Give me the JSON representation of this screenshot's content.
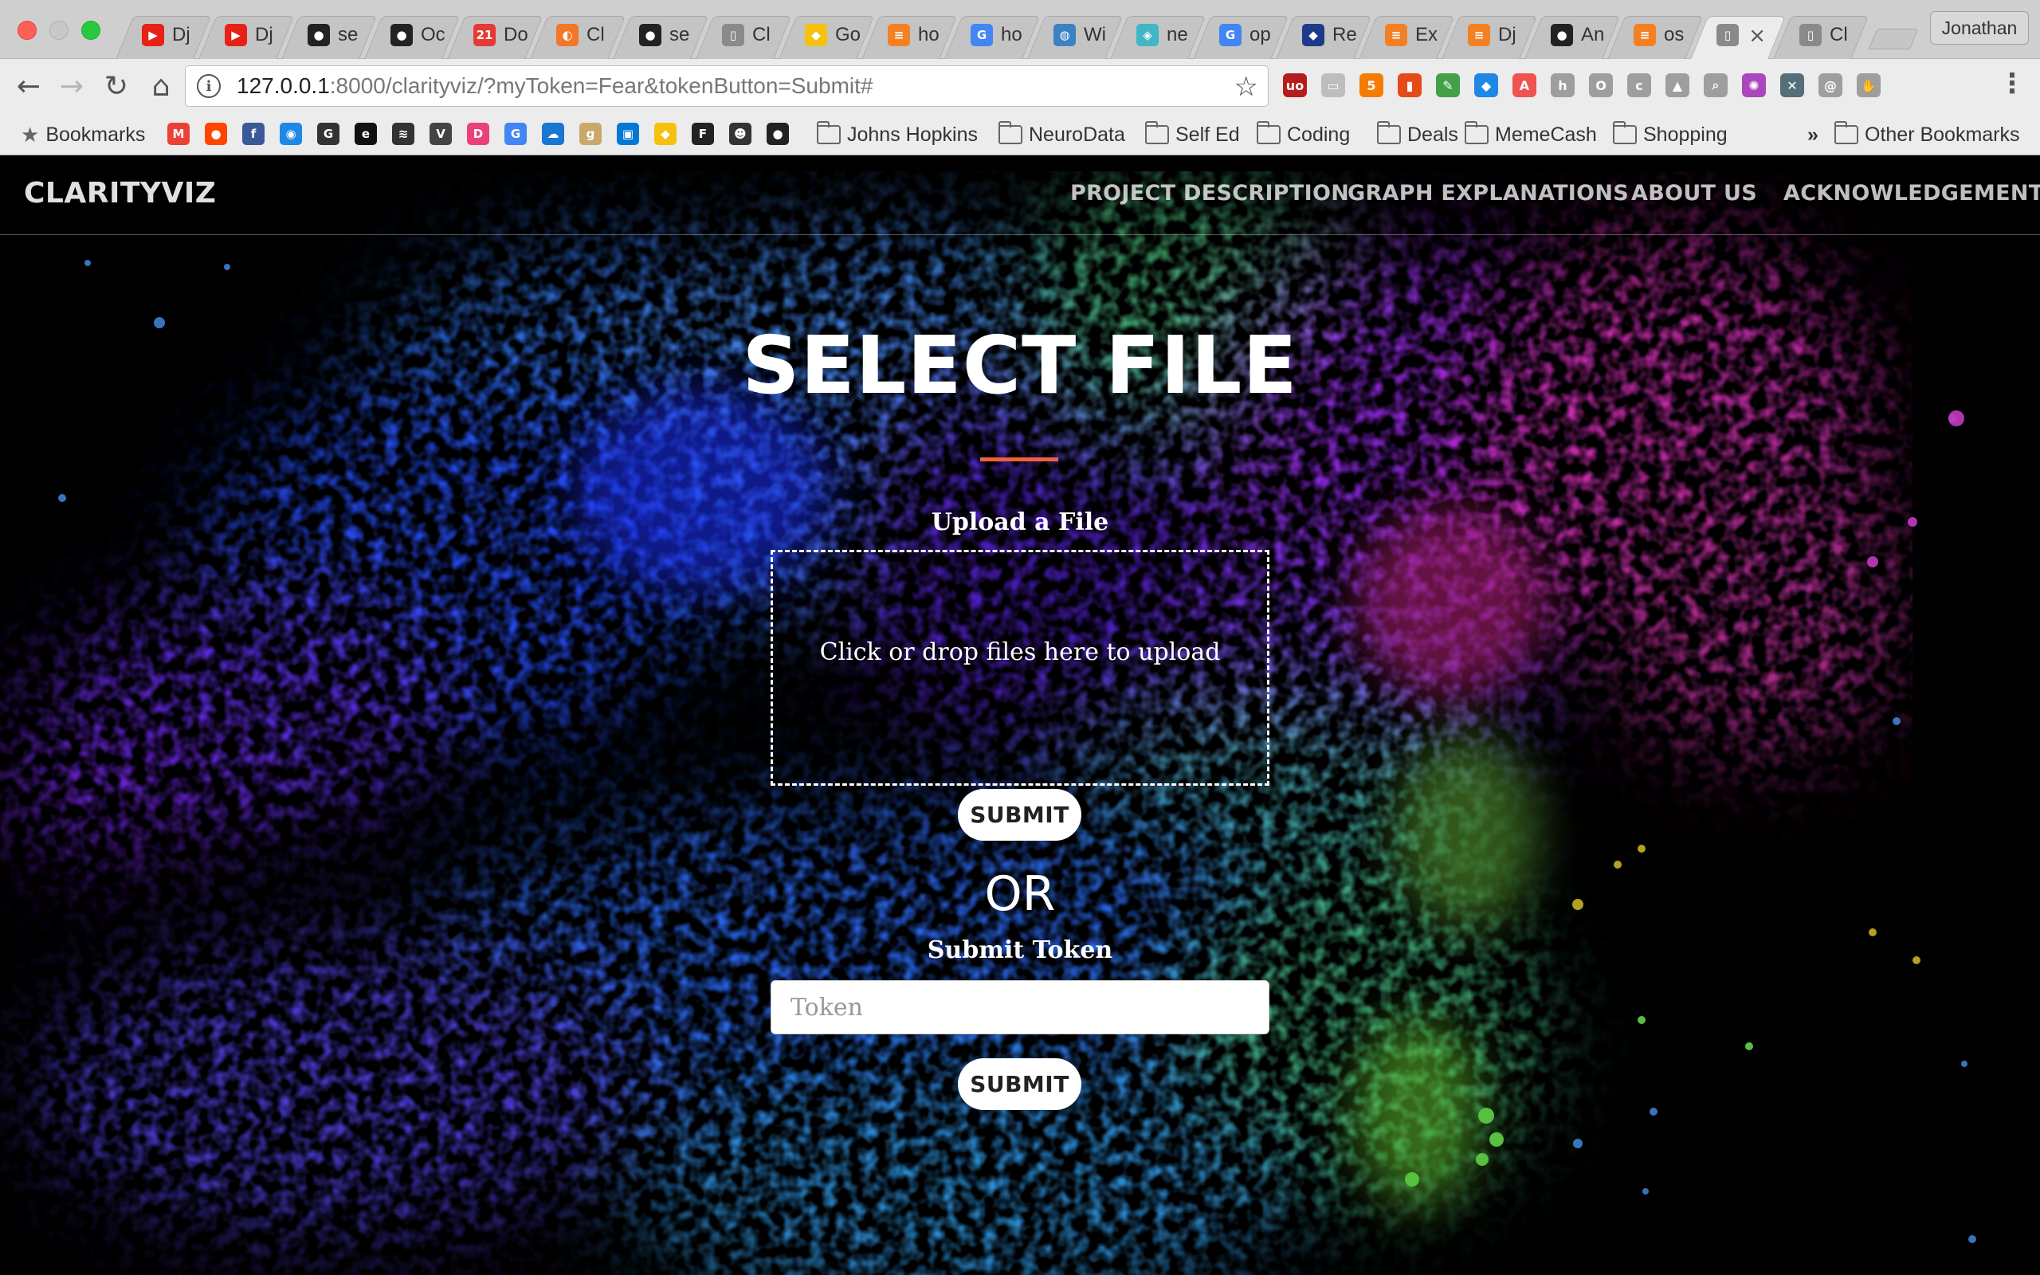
{
  "browser": {
    "tabs": [
      {
        "title": "Dj",
        "icon": "youtube-icon",
        "color": "#e62117",
        "glyph": "▶"
      },
      {
        "title": "Dj",
        "icon": "youtube-icon",
        "color": "#e62117",
        "glyph": "▶"
      },
      {
        "title": "se",
        "icon": "github-icon",
        "color": "#222222",
        "glyph": "●"
      },
      {
        "title": "Oc",
        "icon": "github-icon",
        "color": "#222222",
        "glyph": "●"
      },
      {
        "title": "Do",
        "icon": "calendar-icon",
        "color": "#e53935",
        "glyph": "21"
      },
      {
        "title": "Cl",
        "icon": "jupyter-icon",
        "color": "#f37726",
        "glyph": "◐"
      },
      {
        "title": "se",
        "icon": "github-icon",
        "color": "#222222",
        "glyph": "●"
      },
      {
        "title": "Cl",
        "icon": "document-icon",
        "color": "#8a8a8a",
        "glyph": "▯"
      },
      {
        "title": "Go",
        "icon": "lightbulb-icon",
        "color": "#f4c20d",
        "glyph": "◆"
      },
      {
        "title": "ho",
        "icon": "stackoverflow-icon",
        "color": "#f48024",
        "glyph": "≡"
      },
      {
        "title": "ho",
        "icon": "google-icon",
        "color": "#4285f4",
        "glyph": "G"
      },
      {
        "title": "Wi",
        "icon": "globe-icon",
        "color": "#3b82c4",
        "glyph": "◍"
      },
      {
        "title": "ne",
        "icon": "image-icon",
        "color": "#41b6c4",
        "glyph": "◈"
      },
      {
        "title": "op",
        "icon": "google-icon",
        "color": "#4285f4",
        "glyph": "G"
      },
      {
        "title": "Re",
        "icon": "shield-icon",
        "color": "#1e3a8a",
        "glyph": "◆"
      },
      {
        "title": "Ex",
        "icon": "stackoverflow-icon",
        "color": "#f48024",
        "glyph": "≡"
      },
      {
        "title": "Dj",
        "icon": "stackoverflow-icon",
        "color": "#f48024",
        "glyph": "≡"
      },
      {
        "title": "An",
        "icon": "github-icon",
        "color": "#222222",
        "glyph": "●"
      },
      {
        "title": "os",
        "icon": "stackoverflow-icon",
        "color": "#f48024",
        "glyph": "≡"
      },
      {
        "title": "",
        "icon": "document-icon",
        "color": "#8a8a8a",
        "glyph": "▯",
        "active": true
      },
      {
        "title": "Cl",
        "icon": "document-icon",
        "color": "#8a8a8a",
        "glyph": "▯"
      }
    ],
    "profile_name": "Jonathan",
    "url_host": "127.0.0.1",
    "url_rest": ":8000/clarityviz/?myToken=Fear&tokenButton=Submit#",
    "extensions": [
      {
        "name": "ublock-icon",
        "color": "#b71c1c",
        "glyph": "uo"
      },
      {
        "name": "cast-icon",
        "color": "#bdbdbd",
        "glyph": "▭"
      },
      {
        "name": "html5-icon",
        "color": "#f57c00",
        "glyph": "5"
      },
      {
        "name": "bookmark-red-icon",
        "color": "#e64a19",
        "glyph": "▮"
      },
      {
        "name": "pen-icon",
        "color": "#43a047",
        "glyph": "✎"
      },
      {
        "name": "gem-icon",
        "color": "#1e88e5",
        "glyph": "◆"
      },
      {
        "name": "ad-icon",
        "color": "#ef5350",
        "glyph": "A"
      },
      {
        "name": "hunter-icon",
        "color": "#9e9e9e",
        "glyph": "h"
      },
      {
        "name": "rect-icon",
        "color": "#9e9e9e",
        "glyph": "O"
      },
      {
        "name": "css-icon",
        "color": "#9e9e9e",
        "glyph": "c"
      },
      {
        "name": "drive-icon",
        "color": "#9e9e9e",
        "glyph": "▲"
      },
      {
        "name": "zoom-icon",
        "color": "#9e9e9e",
        "glyph": "⌕"
      },
      {
        "name": "color-wheel-icon",
        "color": "#ab47bc",
        "glyph": "✺"
      },
      {
        "name": "cross-icon",
        "color": "#546e7a",
        "glyph": "✕"
      },
      {
        "name": "spiral-icon",
        "color": "#9e9e9e",
        "glyph": "@"
      },
      {
        "name": "hand-icon",
        "color": "#9e9e9e",
        "glyph": "✋"
      }
    ],
    "bookmarks_label": "Bookmarks",
    "bookmark_favicons": [
      {
        "name": "gmail-icon",
        "color": "#ea4335",
        "glyph": "M"
      },
      {
        "name": "reddit-icon",
        "color": "#ff4500",
        "glyph": "●"
      },
      {
        "name": "facebook-icon",
        "color": "#3b5998",
        "glyph": "f"
      },
      {
        "name": "messenger-icon",
        "color": "#1e88e5",
        "glyph": "◉"
      },
      {
        "name": "g-icon",
        "color": "#333333",
        "glyph": "G"
      },
      {
        "name": "e-icon",
        "color": "#111111",
        "glyph": "e"
      },
      {
        "name": "stripes-icon",
        "color": "#333333",
        "glyph": "≋"
      },
      {
        "name": "v-icon",
        "color": "#444444",
        "glyph": "V"
      },
      {
        "name": "pink-icon",
        "color": "#ec407a",
        "glyph": "D"
      },
      {
        "name": "google-icon",
        "color": "#4285f4",
        "glyph": "G"
      },
      {
        "name": "cloud-icon",
        "color": "#1976d2",
        "glyph": "☁"
      },
      {
        "name": "goodreads-icon",
        "color": "#c9a86a",
        "glyph": "g"
      },
      {
        "name": "outlook-icon",
        "color": "#0078d4",
        "glyph": "▣"
      },
      {
        "name": "lightbulb-icon",
        "color": "#f4c20d",
        "glyph": "◆"
      },
      {
        "name": "f-icon",
        "color": "#222222",
        "glyph": "F"
      },
      {
        "name": "robot-icon",
        "color": "#333333",
        "glyph": "☻"
      },
      {
        "name": "github-icon",
        "color": "#222222",
        "glyph": "●"
      }
    ],
    "folders": [
      "Johns Hopkins",
      "NeuroData",
      "Self Ed",
      "Coding",
      "Deals",
      "MemeCash",
      "Shopping"
    ],
    "overflow": "»",
    "other_bookmarks": "Other Bookmarks"
  },
  "site": {
    "brand": "CLARITYVIZ",
    "nav": [
      "PROJECT DESCRIPTION",
      "GRAPH EXPLANATIONS",
      "ABOUT US",
      "ACKNOWLEDGEMENTS"
    ],
    "title": "SELECT FILE",
    "accent": "#f05f40",
    "upload_label": "Upload a File",
    "dropzone_text": "Click or drop files here to upload",
    "submit_label": "SUBMIT",
    "or_text": "OR",
    "token_label": "Submit Token",
    "token_placeholder": "Token",
    "token_submit_label": "SUBMIT"
  }
}
